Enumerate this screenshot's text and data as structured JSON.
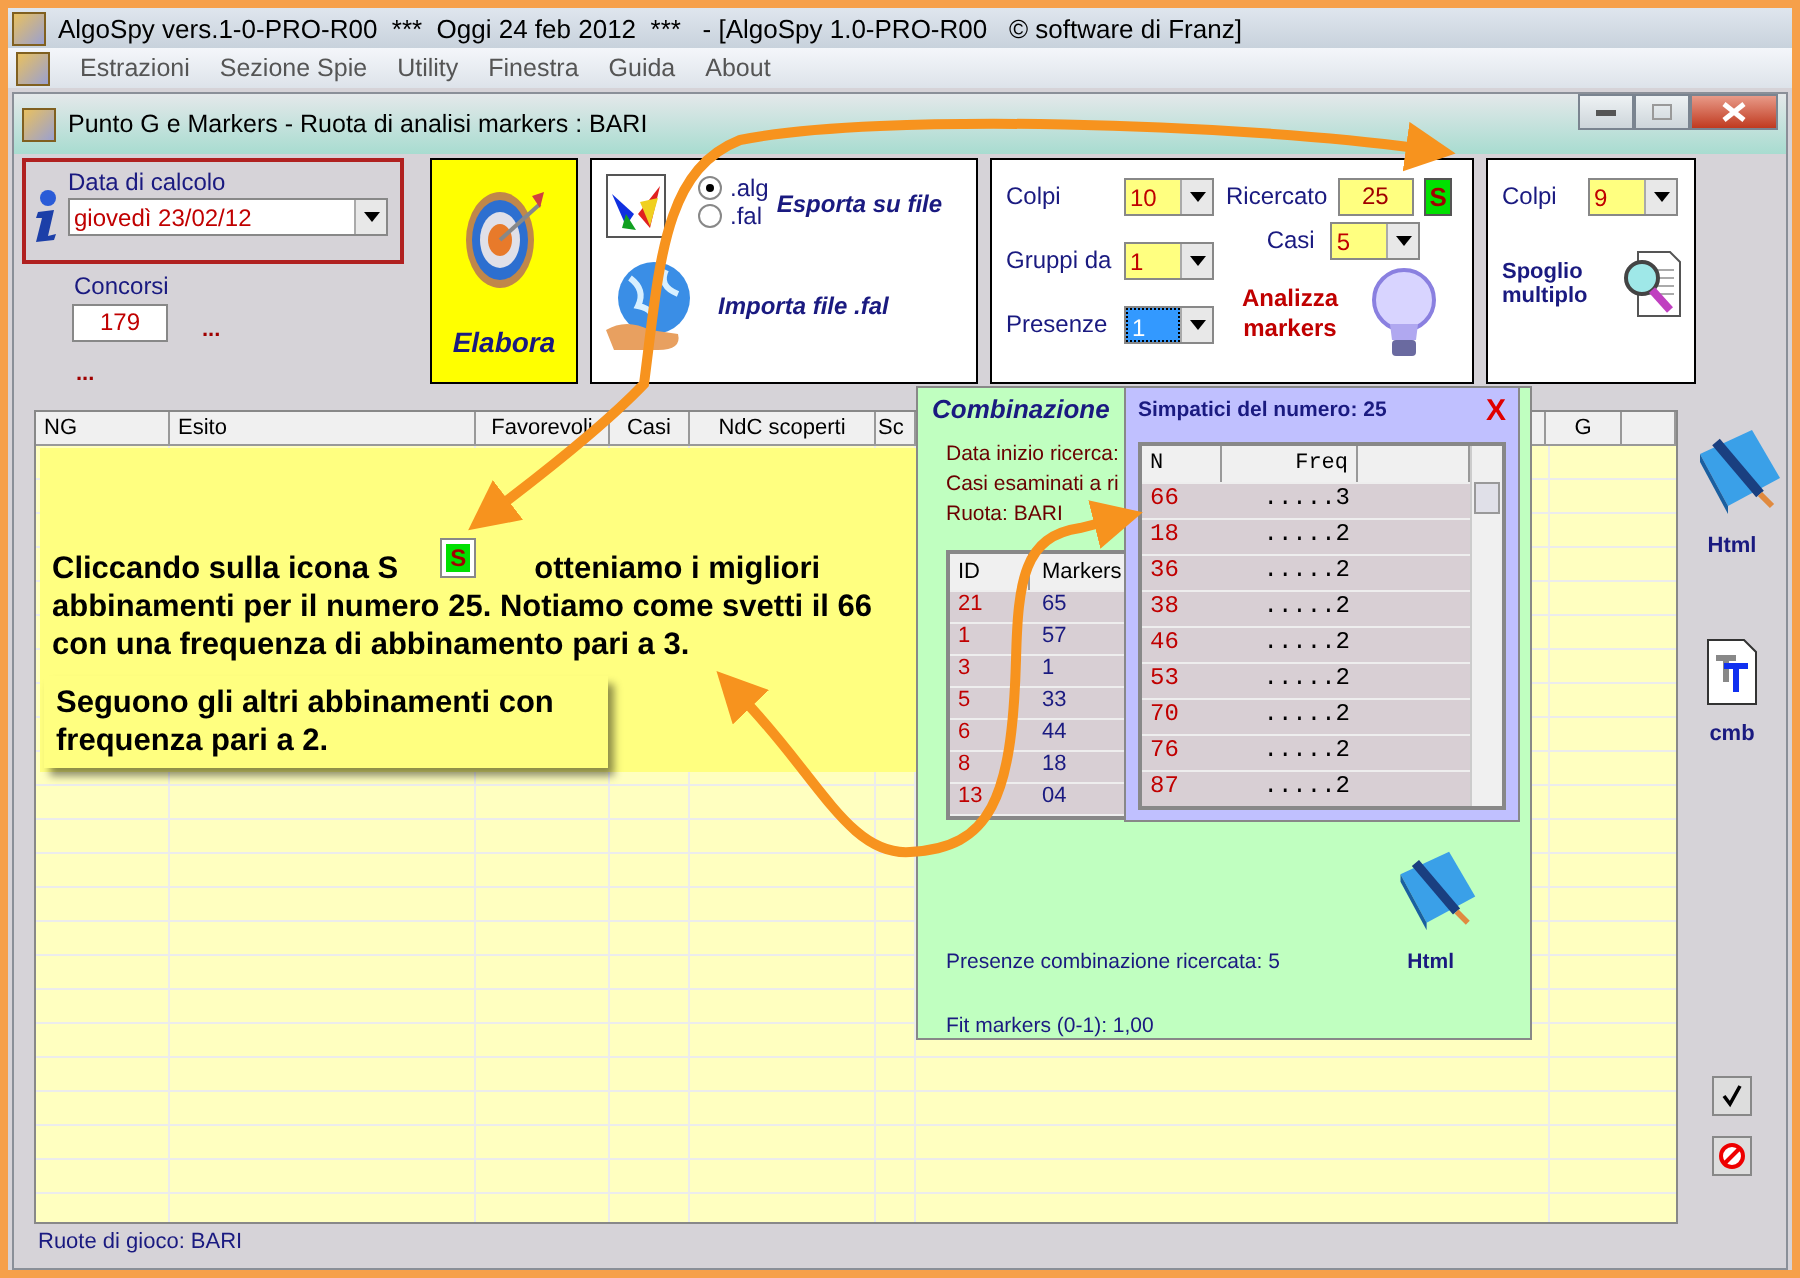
{
  "app_title": "AlgoSpy vers.1-0-PRO-R00  ***  Oggi 24 feb 2012  ***   - [AlgoSpy 1.0-PRO-R00   © software di Franz]",
  "menu": [
    "Estrazioni",
    "Sezione Spie",
    "Utility",
    "Finestra",
    "Guida",
    "About"
  ],
  "child_window": {
    "title": "Punto G e Markers - Ruota di analisi markers : BARI"
  },
  "date": {
    "label": "Data di calcolo",
    "value": "giovedì 23/02/12"
  },
  "concorsi": {
    "label": "Concorsi",
    "value": "179",
    "more_1": "...",
    "more_2": "..."
  },
  "elabora": "Elabora",
  "export": {
    "options": [
      {
        "label": ".alg",
        "selected": true
      },
      {
        "label": ".fal",
        "selected": false
      }
    ],
    "export_label": "Esporta su file",
    "import_label": "Importa file .fal"
  },
  "analysis": {
    "colpi": {
      "label": "Colpi",
      "value": "10"
    },
    "gruppi": {
      "label": "Gruppi da",
      "value": "1"
    },
    "presenze": {
      "label": "Presenze",
      "value": "1"
    },
    "ricercato": {
      "label": "Ricercato",
      "value": "25"
    },
    "s_button": "S",
    "casi": {
      "label": "Casi",
      "value": "5"
    },
    "analyze": "Analizza markers"
  },
  "spoglio": {
    "colpi": {
      "label": "Colpi",
      "value": "9"
    },
    "label": "Spoglio multiplo"
  },
  "table": {
    "columns": [
      "NG",
      "Esito",
      "Favorevoli",
      "Casi",
      "NdC scoperti",
      "Sc",
      "G"
    ]
  },
  "callout": {
    "line_1_start": "Cliccando sulla icona S",
    "s_icon": "S",
    "line_1_end": "otteniamo i migliori",
    "rest": "abbinamenti per il numero 25. Notiamo come svetti il 66 con una frequenza di abbinamento pari a 3.",
    "note": "Seguono gli altri abbinamenti con frequenza pari a 2."
  },
  "combinazione": {
    "title": "Combinazione",
    "lines": [
      "Data inizio ricerca:",
      "Casi esaminati a ri",
      "Ruota: BARI"
    ],
    "columns": [
      "ID",
      "Markers"
    ],
    "rows": [
      [
        "21",
        "65"
      ],
      [
        "1",
        "57"
      ],
      [
        "3",
        "1"
      ],
      [
        "5",
        "33"
      ],
      [
        "6",
        "44"
      ],
      [
        "8",
        "18"
      ],
      [
        "13",
        "04"
      ]
    ],
    "html": "Html",
    "presenze": "Presenze combinazione ricercata: 5",
    "fit": "Fit markers (0-1): 1,00"
  },
  "simpatici": {
    "title": "Simpatici del numero: 25",
    "close": "X",
    "columns": [
      "N",
      "Freq"
    ],
    "rows": [
      [
        "66",
        ".....3"
      ],
      [
        "18",
        ".....2"
      ],
      [
        "36",
        ".....2"
      ],
      [
        "38",
        ".....2"
      ],
      [
        "46",
        ".....2"
      ],
      [
        "53",
        ".....2"
      ],
      [
        "70",
        ".....2"
      ],
      [
        "76",
        ".....2"
      ],
      [
        "87",
        ".....2"
      ]
    ]
  },
  "side": {
    "html": "Html",
    "cmb": "cmb"
  },
  "status": "Ruote di gioco: BARI"
}
